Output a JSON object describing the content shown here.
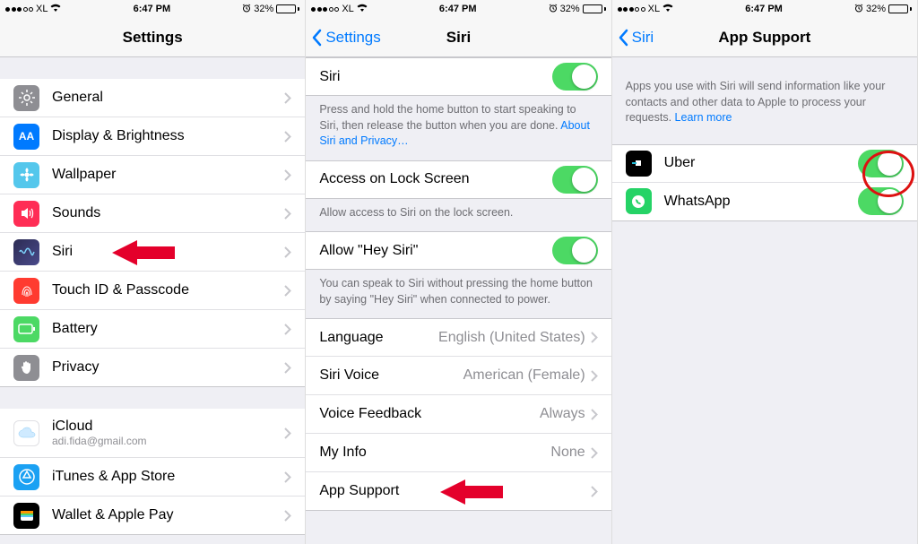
{
  "statusbar": {
    "carrier": "XL",
    "time": "6:47 PM",
    "battery": "32%"
  },
  "screen1": {
    "title": "Settings",
    "groupA": [
      {
        "label": "General",
        "icon": "gear",
        "bg": "#8e8e93"
      },
      {
        "label": "Display & Brightness",
        "icon": "AA",
        "bg": "#007aff"
      },
      {
        "label": "Wallpaper",
        "icon": "flower",
        "bg": "#54c7ec"
      },
      {
        "label": "Sounds",
        "icon": "speaker",
        "bg": "#ff2d55"
      },
      {
        "label": "Siri",
        "icon": "siri",
        "bg": "#1c1c3c"
      },
      {
        "label": "Touch ID & Passcode",
        "icon": "fingerprint",
        "bg": "#ff3b30"
      },
      {
        "label": "Battery",
        "icon": "battery",
        "bg": "#4cd964"
      },
      {
        "label": "Privacy",
        "icon": "hand",
        "bg": "#8e8e93"
      }
    ],
    "groupB": [
      {
        "label": "iCloud",
        "sub": "adi.fida@gmail.com",
        "icon": "cloud",
        "bg": "#ffffff"
      },
      {
        "label": "iTunes & App Store",
        "icon": "appstore",
        "bg": "#1ba1f3"
      },
      {
        "label": "Wallet & Apple Pay",
        "icon": "wallet",
        "bg": "#000000"
      }
    ]
  },
  "screen2": {
    "back": "Settings",
    "title": "Siri",
    "siri_row": "Siri",
    "siri_footer_a": "Press and hold the home button to start speaking to Siri, then release the button when you are done. ",
    "siri_footer_link": "About Siri and Privacy…",
    "lock_row": "Access on Lock Screen",
    "lock_footer": "Allow access to Siri on the lock screen.",
    "hey_row": "Allow \"Hey Siri\"",
    "hey_footer": "You can speak to Siri without pressing the home button by saying \"Hey Siri\" when connected to power.",
    "lang_label": "Language",
    "lang_value": "English (United States)",
    "voice_label": "Siri Voice",
    "voice_value": "American (Female)",
    "feedback_label": "Voice Feedback",
    "feedback_value": "Always",
    "myinfo_label": "My Info",
    "myinfo_value": "None",
    "appsupport_label": "App Support"
  },
  "screen3": {
    "back": "Siri",
    "title": "App Support",
    "header_text": "Apps you use with Siri will send information like your contacts and other data to Apple to process your requests. ",
    "header_link": "Learn more",
    "apps": [
      {
        "label": "Uber",
        "icon": "uber",
        "bg": "#000000"
      },
      {
        "label": "WhatsApp",
        "icon": "whatsapp",
        "bg": "#25d366"
      }
    ]
  }
}
